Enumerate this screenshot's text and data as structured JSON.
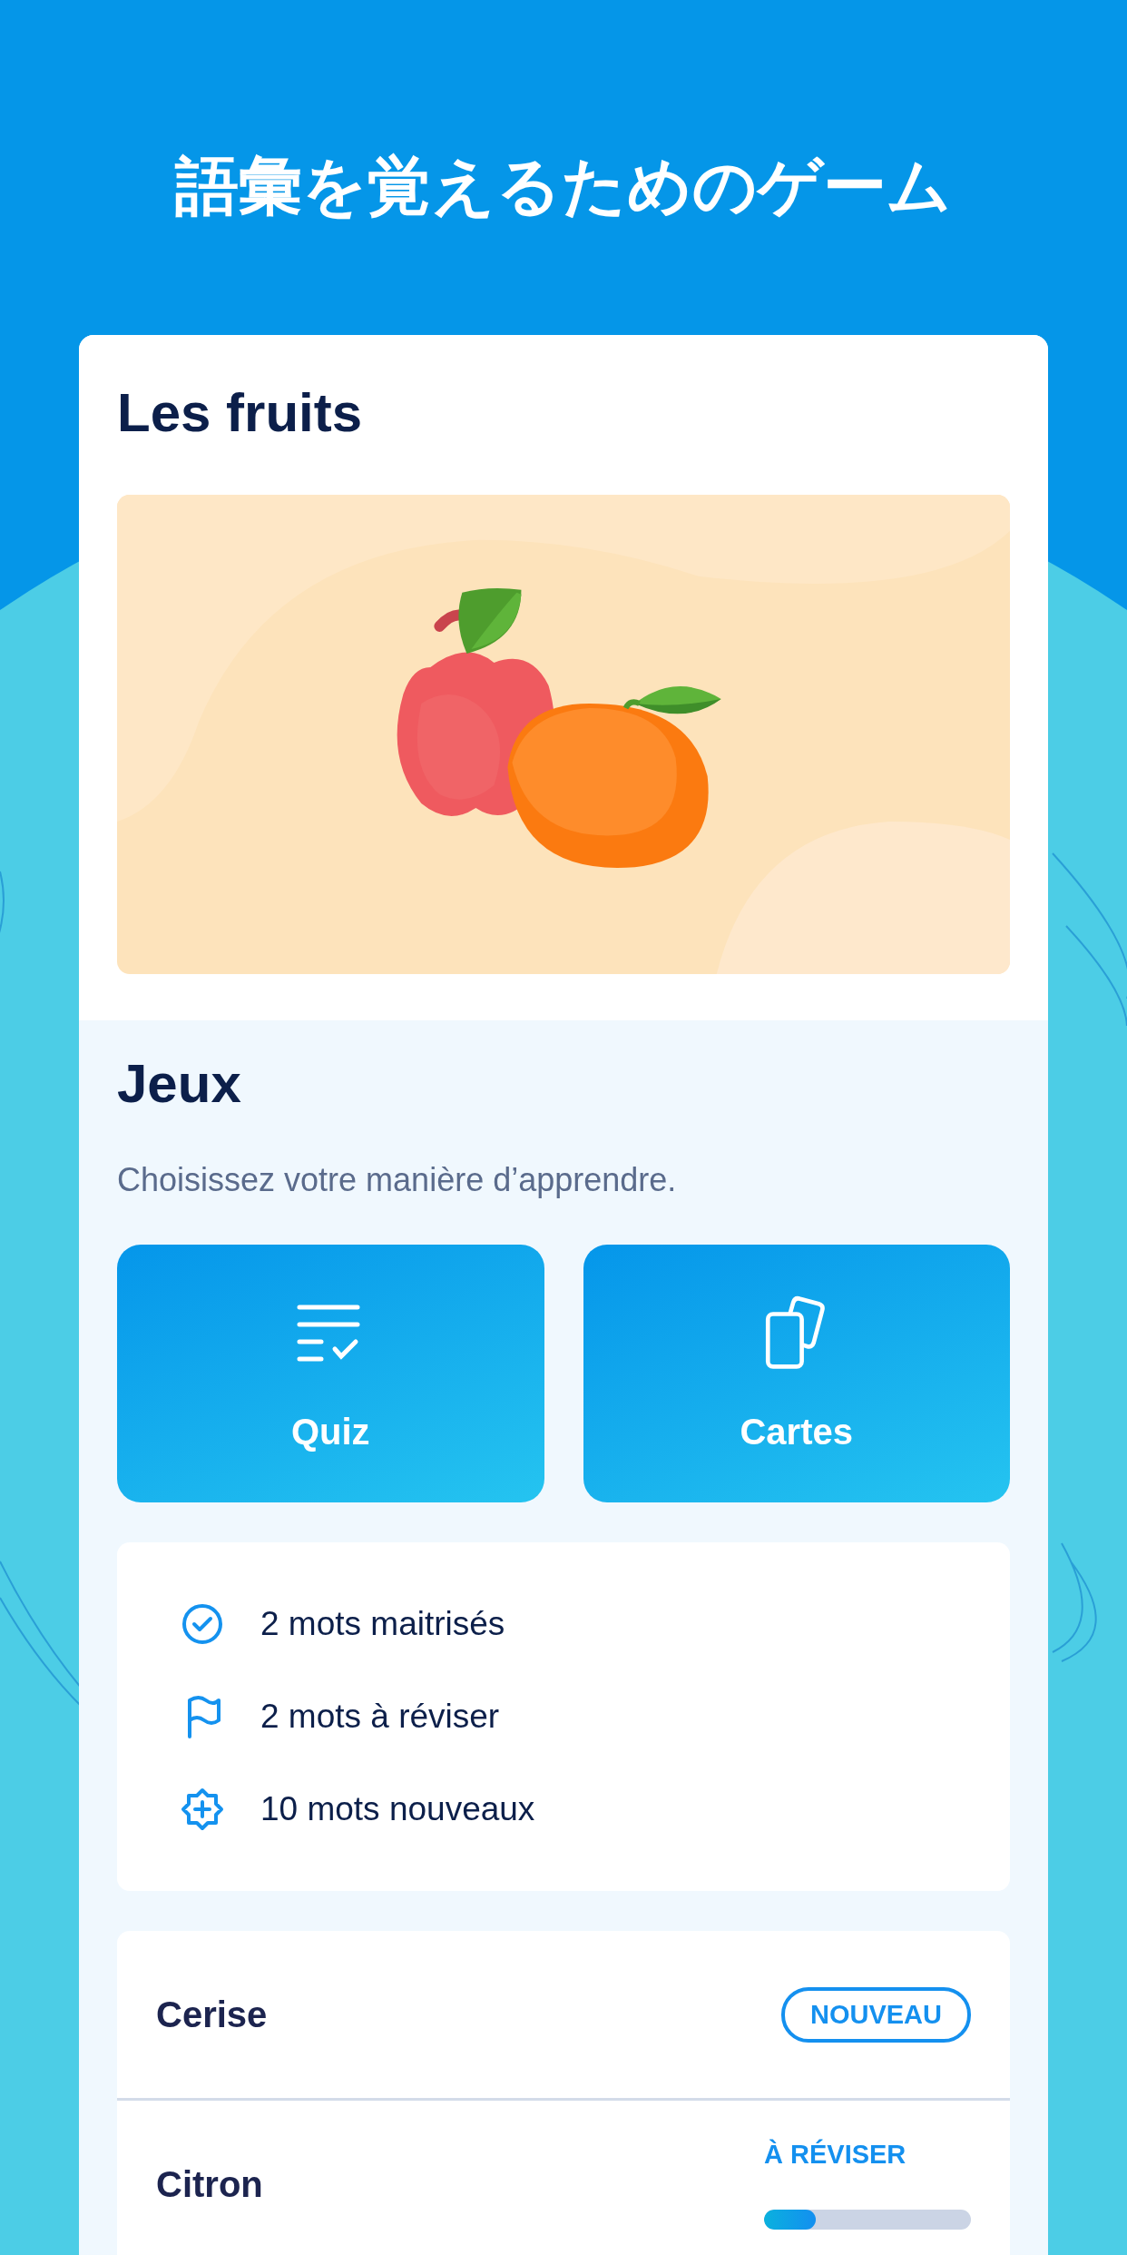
{
  "headline": "語彙を覚えるためのゲーム",
  "lesson": {
    "title": "Les fruits"
  },
  "games": {
    "title": "Jeux",
    "subtitle": "Choisissez votre manière d’apprendre.",
    "buttons": [
      {
        "kind": "quiz",
        "label": "Quiz"
      },
      {
        "kind": "cards",
        "label": "Cartes"
      }
    ]
  },
  "stats": [
    {
      "kind": "mastered",
      "text": "2 mots maitrisés"
    },
    {
      "kind": "review",
      "text": "2 mots à réviser"
    },
    {
      "kind": "new",
      "text": "10 mots nouveaux"
    }
  ],
  "words": [
    {
      "word": "Cerise",
      "kind": "badge",
      "status": "NOUVEAU"
    },
    {
      "word": "Citron",
      "kind": "progress",
      "status": "À RÉVISER",
      "level": 0.25
    }
  ]
}
